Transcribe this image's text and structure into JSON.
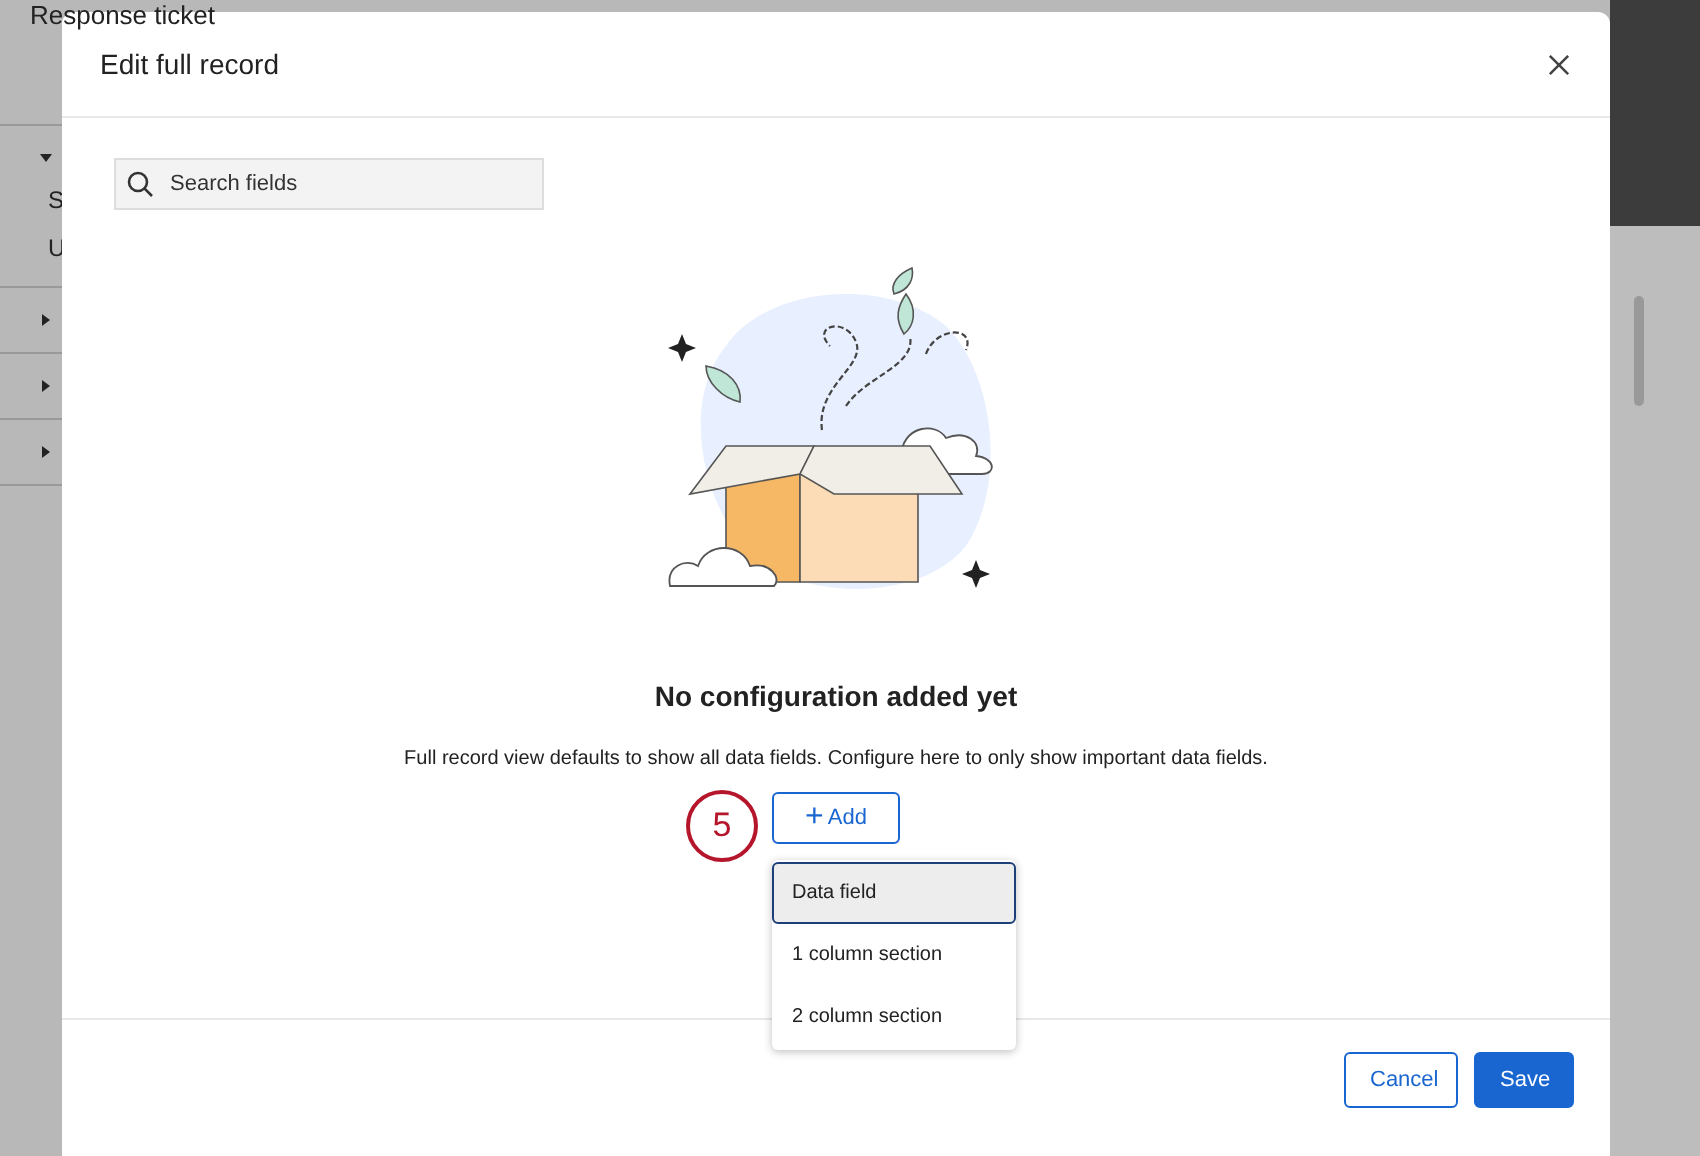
{
  "background": {
    "title": "Response ticket",
    "sections": [
      {
        "expanded": true,
        "items": [
          "S",
          "U"
        ]
      },
      {
        "expanded": false
      },
      {
        "expanded": false
      },
      {
        "expanded": false
      }
    ]
  },
  "dialog": {
    "title": "Edit full record",
    "search": {
      "placeholder": "Search fields"
    },
    "empty_state": {
      "heading": "No configuration added yet",
      "description": "Full record view defaults to show all data fields. Configure here to only show important data fields."
    },
    "add_button": {
      "icon": "+",
      "label": "Add"
    },
    "add_menu": [
      {
        "label": "Data field",
        "selected": true
      },
      {
        "label": "1 column section",
        "selected": false
      },
      {
        "label": "2 column section",
        "selected": false
      }
    ],
    "buttons": [
      {
        "label": "Cancel",
        "kind": "secondary"
      },
      {
        "label": "Save",
        "kind": "primary"
      }
    ]
  },
  "step_marker": "5"
}
